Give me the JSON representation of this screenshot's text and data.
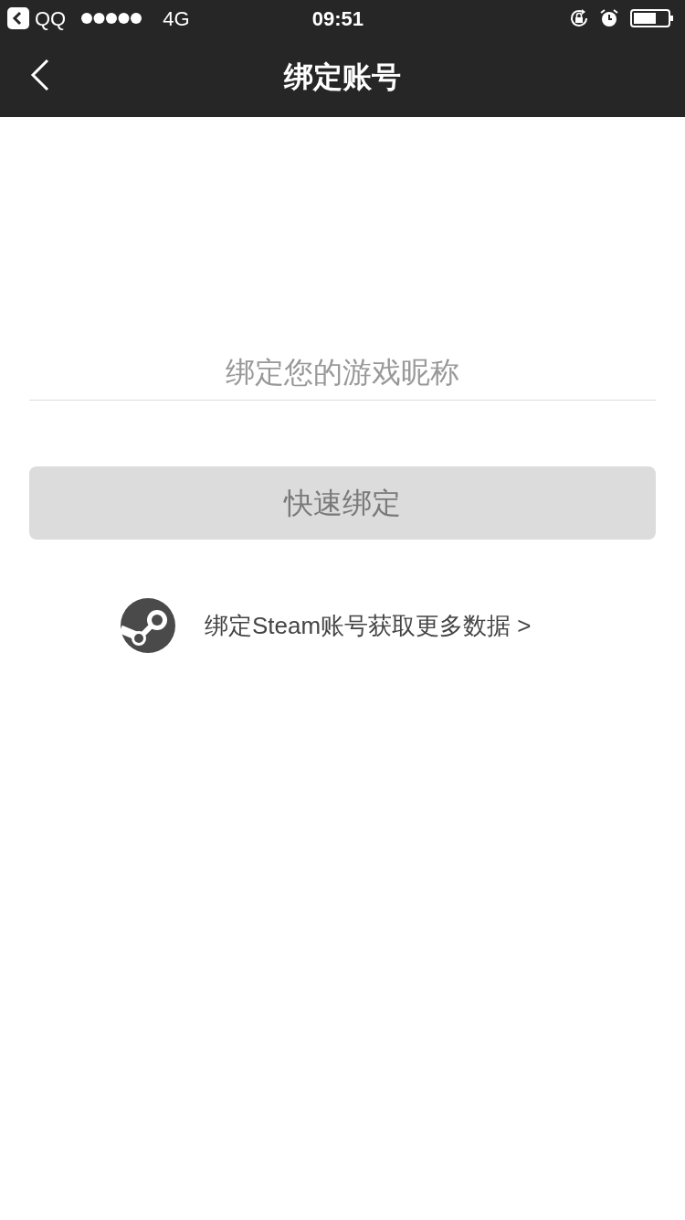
{
  "status_bar": {
    "back_app": "QQ",
    "network": "4G",
    "time": "09:51"
  },
  "nav": {
    "title": "绑定账号"
  },
  "nickname_field": {
    "placeholder": "绑定您的游戏昵称"
  },
  "bind_button": {
    "label": "快速绑定",
    "disabled": true
  },
  "steam_link": {
    "label": "绑定Steam账号获取更多数据 >"
  }
}
